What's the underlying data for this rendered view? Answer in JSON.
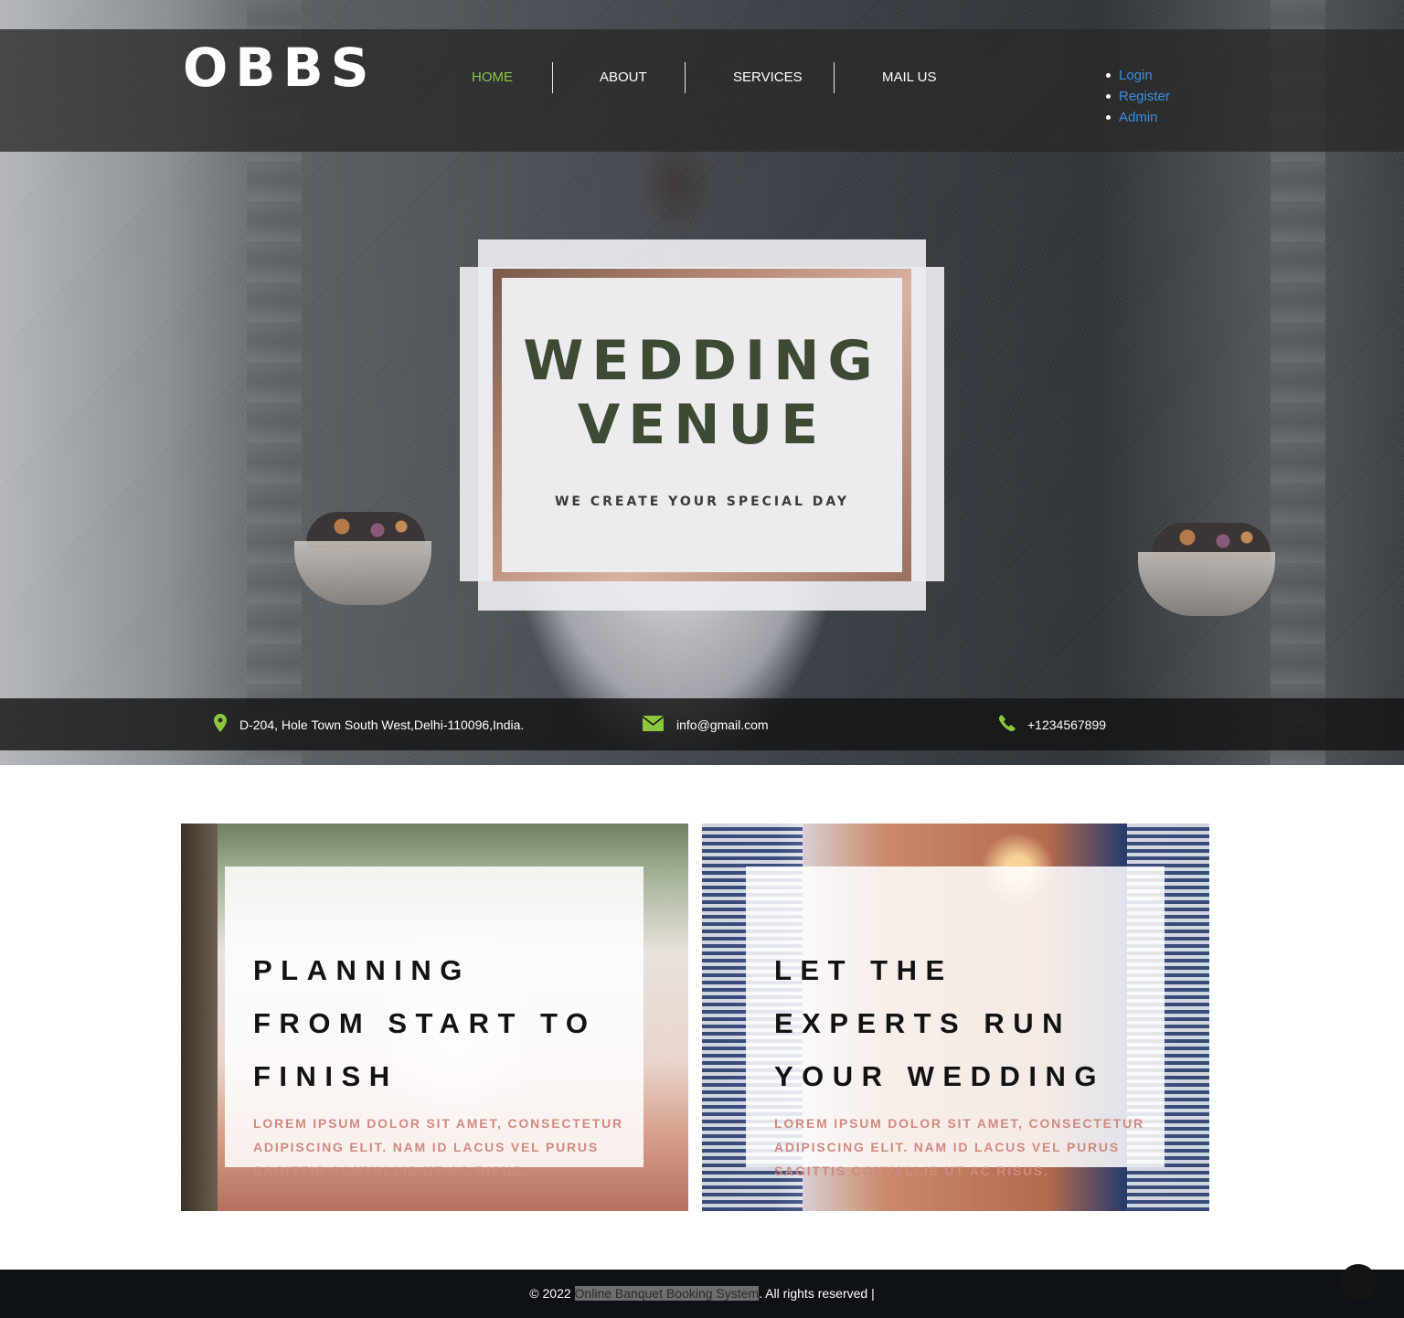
{
  "brand": {
    "logo": "OBBS"
  },
  "nav": {
    "links": [
      {
        "label": "HOME",
        "active": true
      },
      {
        "label": "ABOUT",
        "active": false
      },
      {
        "label": "SERVICES",
        "active": false
      },
      {
        "label": "MAIL US",
        "active": false
      }
    ],
    "auth": [
      "Login",
      "Register",
      "Admin"
    ]
  },
  "hero": {
    "title_line1": "WEDDING",
    "title_line2": "VENUE",
    "subtitle": "WE CREATE YOUR SPECIAL DAY"
  },
  "contact": {
    "address": "D-204, Hole Town South West,Delhi-110096,India.",
    "email": "info@gmail.com",
    "phone": "+1234567899",
    "icons": [
      "map-marker-icon",
      "envelope-icon",
      "phone-icon"
    ]
  },
  "cards": [
    {
      "title_lines": [
        "PLANNING",
        "FROM START TO",
        "FINISH"
      ],
      "text_lines": [
        "LOREM IPSUM DOLOR SIT AMET, CONSECTETUR",
        "ADIPISCING ELIT. NAM ID LACUS VEL PURUS",
        "SAGITTIS CONVALLIS UT AC RISUS."
      ]
    },
    {
      "title_lines": [
        "LET THE",
        "EXPERTS RUN",
        "YOUR WEDDING"
      ],
      "text_lines": [
        "LOREM IPSUM DOLOR SIT AMET, CONSECTETUR",
        "ADIPISCING ELIT. NAM ID LACUS VEL PURUS",
        "SAGITTIS CONVALLIS UT AC RISUS."
      ]
    }
  ],
  "footer": {
    "prefix": "© 2022 ",
    "link": "Online Banquet Booking System",
    "suffix": ". All rights reserved |"
  },
  "colors": {
    "accent": "#8dc63f",
    "auth_link": "#3a8ee0",
    "card_text": "#cf8a80",
    "footer_bg": "#0e1116"
  }
}
